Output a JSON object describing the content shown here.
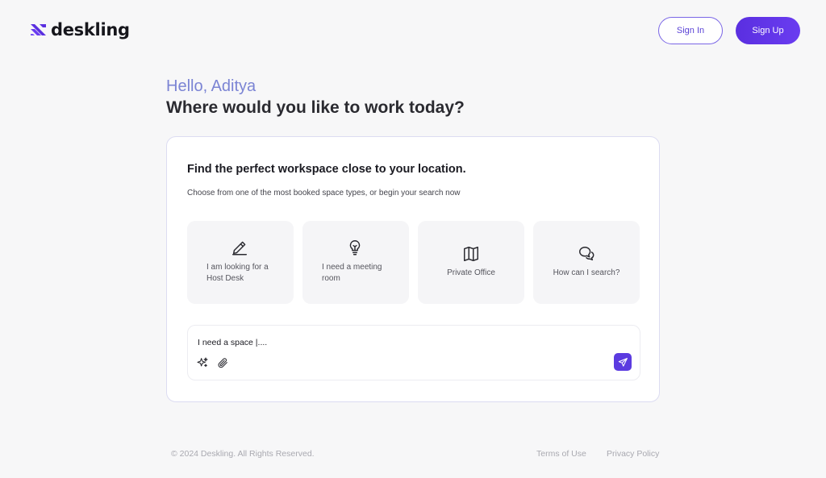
{
  "header": {
    "brand": "deskling",
    "sign_in": "Sign In",
    "sign_up": "Sign Up"
  },
  "greeting": {
    "hello": "Hello, Aditya",
    "headline": "Where would you like to work today?"
  },
  "card": {
    "title": "Find the perfect workspace close to your location.",
    "subtitle": "Choose from one of the most booked space types, or begin your search now",
    "options": [
      {
        "label": "I am looking for a Host Desk",
        "icon": "pencil-icon"
      },
      {
        "label": "I need a meeting room",
        "icon": "lightbulb-icon"
      },
      {
        "label": "Private Office",
        "icon": "map-icon"
      },
      {
        "label": "How can I search?",
        "icon": "chat-bubbles-icon"
      }
    ],
    "composer": {
      "placeholder": "I need a space |....",
      "tools": [
        "sparkle-icon",
        "paperclip-icon"
      ],
      "send_icon": "send-icon"
    }
  },
  "footer": {
    "copyright": "© 2024 Deskling. All Rights Reserved.",
    "terms": "Terms of Use",
    "privacy": "Privacy Policy"
  },
  "colors": {
    "accent": "#5b3be0",
    "greeting": "#7b84d4",
    "background": "#f7f7f8"
  }
}
